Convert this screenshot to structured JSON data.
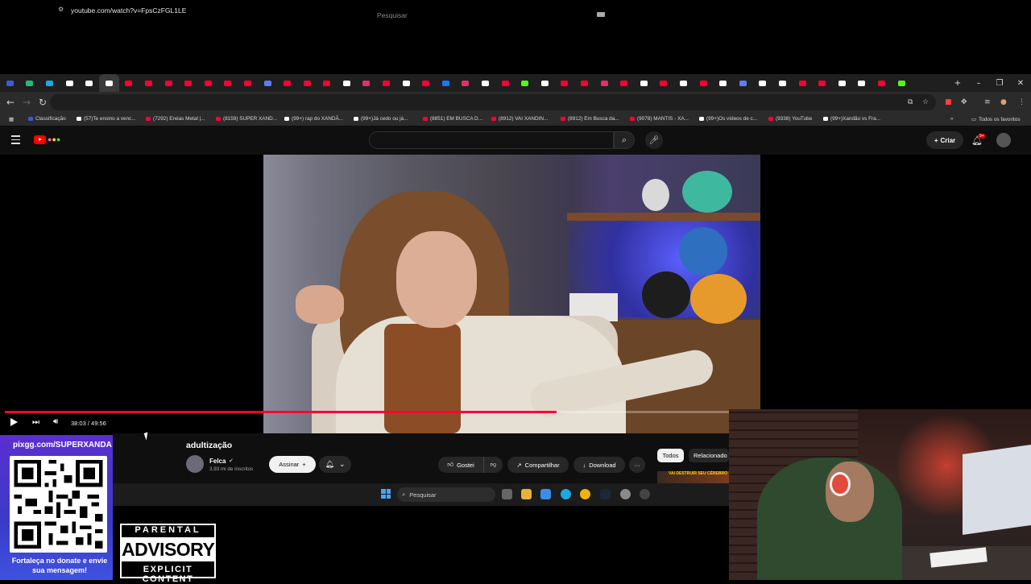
{
  "browser": {
    "url": "youtube.com/watch?v=FpsCzFGL1LE",
    "tab_colors": [
      "#3b5bdb",
      "#2bb673",
      "#1ea7e1",
      "#ffffff",
      "#ffffff",
      "#ffffff",
      "#ff0033",
      "#ff0033",
      "#ff0033",
      "#ff0033",
      "#ff0033",
      "#ff0033",
      "#ff0033",
      "#5c7cfa",
      "#ff0033",
      "#ff0033",
      "#ff0033",
      "#ffffff",
      "#e1306c",
      "#ff0033",
      "#ffffff",
      "#ff0033",
      "#1877f2",
      "#e1306c",
      "#ffffff",
      "#ff0033",
      "#53fc18",
      "#ffffff",
      "#ff0033",
      "#ff0033",
      "#e1306c",
      "#ff0033",
      "#ffffff",
      "#ff0033",
      "#ffffff",
      "#ff0033",
      "#ffffff",
      "#5c7cfa",
      "#ffffff",
      "#ffffff",
      "#ff0033",
      "#ff0033",
      "#ffffff",
      "#ffffff",
      "#ff0033",
      "#53fc18"
    ],
    "window_controls": [
      "–",
      "❐",
      "✕"
    ],
    "bookmarks": [
      {
        "label": "Classificação",
        "color": "#3b5bdb"
      },
      {
        "label": "(57)Te ensino a venc...",
        "color": "#ffffff"
      },
      {
        "label": "(7292) Enéas Metal |...",
        "color": "#ff0033"
      },
      {
        "label": "(8159) SUPER XAND...",
        "color": "#ff0033"
      },
      {
        "label": "(99+) rap do XANDÃ...",
        "color": "#ffffff"
      },
      {
        "label": "(99+)Já cedo ou já...",
        "color": "#ffffff"
      },
      {
        "label": "(8851) EM BUSCA D...",
        "color": "#ff0033"
      },
      {
        "label": "(8912) VAI XANDIN...",
        "color": "#ff0033"
      },
      {
        "label": "(8912) Em Busca da...",
        "color": "#ff0033"
      },
      {
        "label": "(9078) MANTIS - XA...",
        "color": "#ff0033"
      },
      {
        "label": "(99+)Os vídeos de c...",
        "color": "#ffffff"
      },
      {
        "label": "(9338) YouTube",
        "color": "#ff0033"
      },
      {
        "label": "(99+)Xandão vs Fra...",
        "color": "#ffffff"
      }
    ],
    "all_favorites": "Todos os favoritos"
  },
  "youtube": {
    "search_placeholder": "Pesquisar",
    "create_label": "Criar",
    "notif_badge": "9+",
    "player": {
      "time": "38:03 / 49:56",
      "progress": 0.762
    },
    "video_title": "adultização",
    "channel": {
      "name": "Felca",
      "subs": "3,93 mi de inscritos"
    },
    "subscribe_label": "Assinar",
    "like_label": "Gostei",
    "share_label": "Compartilhar",
    "download_label": "Download",
    "chips": [
      "Todos",
      "Relacionado"
    ],
    "thumb_text": "VAI DESTRUIR SEU CÉREBRO"
  },
  "taskbar": {
    "search_label": "Pesquisar"
  },
  "overlay": {
    "qr_url": "pixgg.com/SUPERXANDA",
    "qr_message": "Fortaleça no donate e envie sua mensagem!",
    "advisory_top": "PARENTAL",
    "advisory_mid": "ADVISORY",
    "advisory_bot": "EXPLICIT CONTENT"
  }
}
